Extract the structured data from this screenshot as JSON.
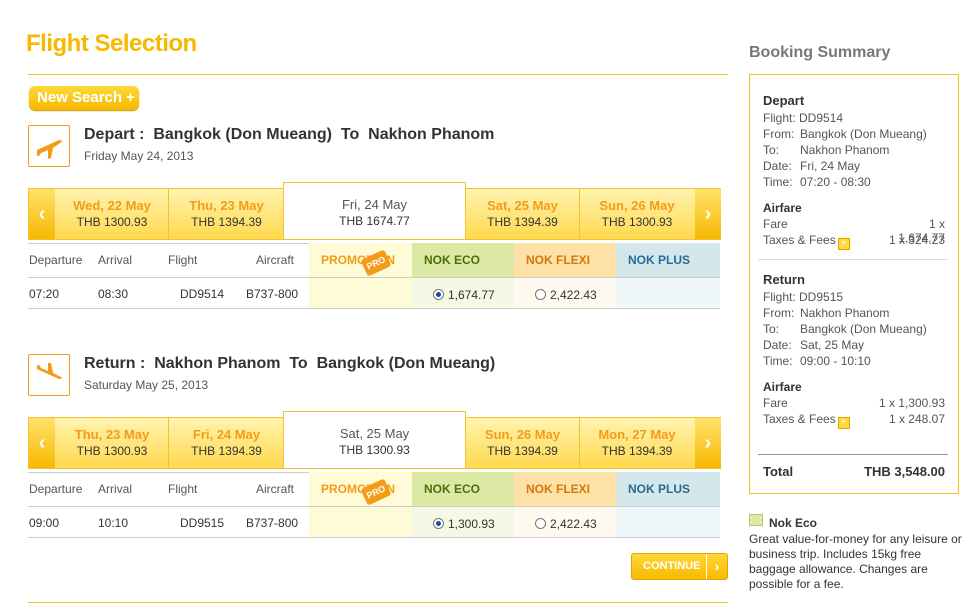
{
  "page_title": "Flight Selection",
  "new_search_label": "New Search",
  "new_search_plus": "+",
  "columns": {
    "departure": "Departure",
    "arrival": "Arrival",
    "flight": "Flight",
    "aircraft": "Aircraft",
    "promo": "PROMOTION",
    "promo_tag": "PRO",
    "eco": "NOK ECO",
    "flexi": "NOK FLEXI",
    "plus": "NOK PLUS"
  },
  "depart": {
    "title_prefix": "Depart :",
    "title_from": "Bangkok (Don Mueang)",
    "title_to_word": "To",
    "title_to": "Nakhon Phanom",
    "date_text": "Friday May 24, 2013",
    "dates": [
      {
        "day": "Wed, 22 May",
        "price": "THB 1300.93"
      },
      {
        "day": "Thu, 23 May",
        "price": "THB 1394.39"
      },
      {
        "day": "Fri, 24 May",
        "price": "THB 1674.77"
      },
      {
        "day": "Sat, 25 May",
        "price": "THB 1394.39"
      },
      {
        "day": "Sun, 26 May",
        "price": "THB 1300.93"
      }
    ],
    "row": {
      "departure": "07:20",
      "arrival": "08:30",
      "flight": "DD9514",
      "aircraft": "B737-800",
      "eco": "1,674.77",
      "flexi": "2,422.43"
    }
  },
  "return": {
    "title_prefix": "Return :",
    "title_from": "Nakhon Phanom",
    "title_to_word": "To",
    "title_to": "Bangkok (Don Mueang)",
    "date_text": "Saturday May 25, 2013",
    "dates": [
      {
        "day": "Thu, 23 May",
        "price": "THB 1300.93"
      },
      {
        "day": "Fri, 24 May",
        "price": "THB 1394.39"
      },
      {
        "day": "Sat, 25 May",
        "price": "THB 1300.93"
      },
      {
        "day": "Sun, 26 May",
        "price": "THB 1394.39"
      },
      {
        "day": "Mon, 27 May",
        "price": "THB 1394.39"
      }
    ],
    "row": {
      "departure": "09:00",
      "arrival": "10:10",
      "flight": "DD9515",
      "aircraft": "B737-800",
      "eco": "1,300.93",
      "flexi": "2,422.43"
    }
  },
  "continue_label": "CONTINUE",
  "continue_arrow": "›",
  "arrow_left": "‹",
  "arrow_right": "›",
  "summary": {
    "title": "Booking Summary",
    "depart": {
      "heading": "Depart",
      "flight": "Flight: DD9514",
      "from_label": "From:",
      "from": "Bangkok (Don Mueang)",
      "to_label": "To:",
      "to": "Nakhon Phanom",
      "date_label": "Date:",
      "date": "Fri, 24 May",
      "time_label": "Time:",
      "time": "07:20 - 08:30",
      "airfare": "Airfare",
      "fare_label": "Fare",
      "fare": "1 x 1,674.77",
      "tax_label": "Taxes & Fees",
      "tax": "1 x 324.23"
    },
    "return": {
      "heading": "Return",
      "flight": "Flight: DD9515",
      "from_label": "From:",
      "from": "Nakhon Phanom",
      "to_label": "To:",
      "to": "Bangkok (Don Mueang)",
      "date_label": "Date:",
      "date": "Sat, 25 May",
      "time_label": "Time:",
      "time": "09:00 - 10:10",
      "airfare": "Airfare",
      "fare_label": "Fare",
      "fare": "1 x 1,300.93",
      "tax_label": "Taxes & Fees",
      "tax": "1 x 248.07"
    },
    "total_label": "Total",
    "total": "THB 3,548.00",
    "plus_sign": "+"
  },
  "nok_eco_note": {
    "title": "Nok Eco",
    "text": "Great value-for-money for any leisure or business trip. Includes 15kg free baggage allowance. Changes are possible for a fee."
  },
  "colors": {
    "accent": "#f6b800",
    "orange": "#f39c1a",
    "eco": "#dce9a5",
    "flexi": "#fde1a6",
    "plus": "#d4e8ec"
  }
}
